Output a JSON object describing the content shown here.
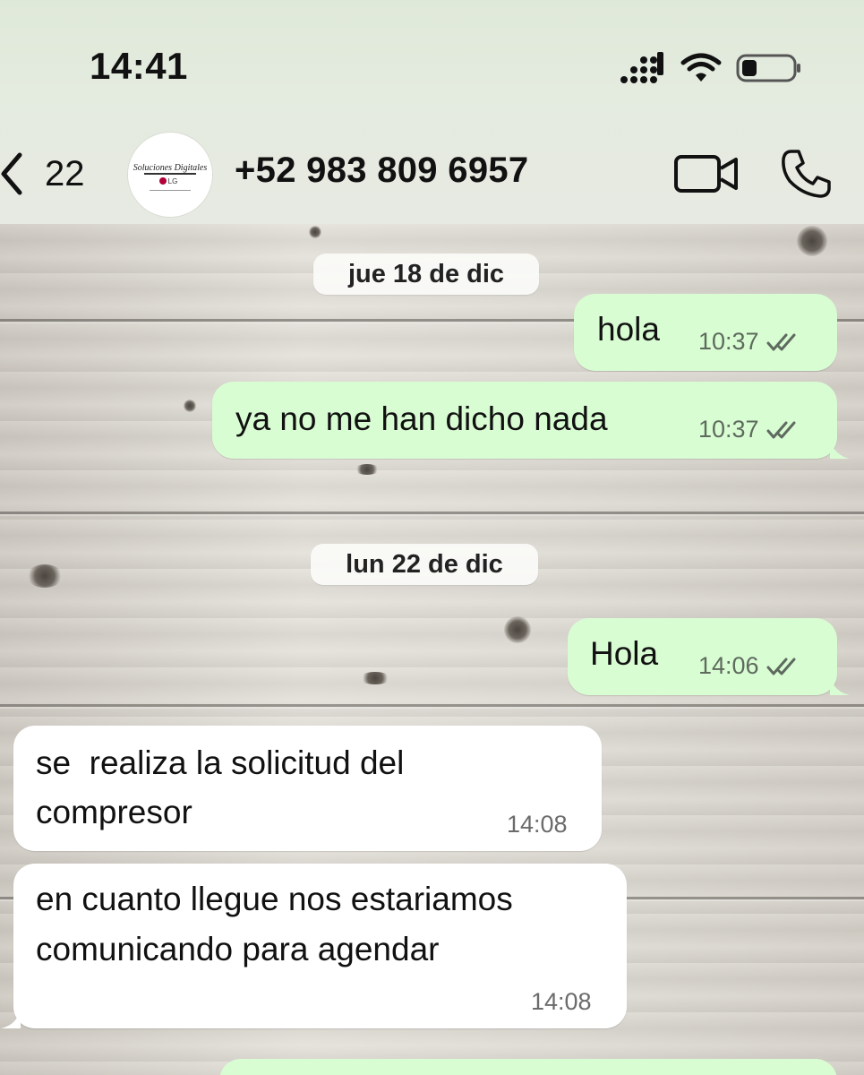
{
  "status_bar": {
    "time": "14:41"
  },
  "header": {
    "back_count": "22",
    "contact": "+52 983 809 6957",
    "avatar_logo_text": "Soluciones Digitales",
    "avatar_logo_brand": "LG",
    "icons": [
      "back-chevron-icon",
      "video-call-icon",
      "phone-call-icon"
    ]
  },
  "chat": {
    "dates": [
      {
        "label": "jue 18 de dic"
      },
      {
        "label": "lun 22 de dic"
      }
    ],
    "messages": [
      {
        "direction": "out",
        "text": "hola",
        "time": "10:37",
        "status": "read"
      },
      {
        "direction": "out",
        "text": "ya no me han dicho nada",
        "time": "10:37",
        "status": "read"
      },
      {
        "direction": "out",
        "text": "Hola",
        "time": "14:06",
        "status": "read"
      },
      {
        "direction": "in",
        "text_line1": "se  realiza la solicitud del",
        "text_line2": "compresor",
        "time": "14:08"
      },
      {
        "direction": "in",
        "text_line1": "en cuanto llegue nos estariamos",
        "text_line2": "comunicando para agendar",
        "time": "14:08"
      }
    ]
  },
  "colors": {
    "outgoing_bubble": "#d9fdd3",
    "incoming_bubble": "#ffffff",
    "header_background": "#e4ebdf",
    "read_ticks": "#5e6a5e"
  }
}
